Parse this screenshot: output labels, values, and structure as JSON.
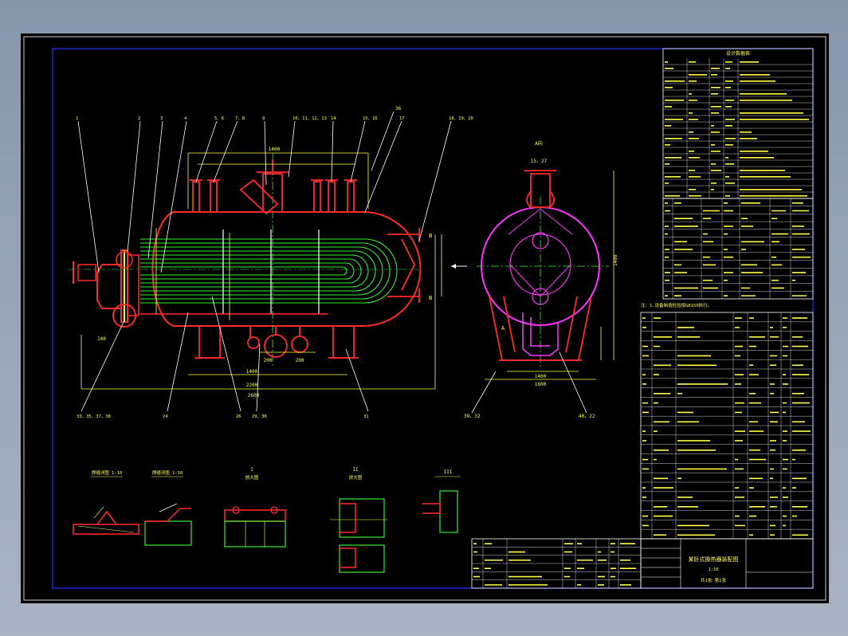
{
  "drawing": {
    "main_view_callouts": [
      "1",
      "2",
      "3",
      "4",
      "5、6",
      "7、8",
      "9",
      "10、11、12、13",
      "14",
      "15、16",
      "17",
      "18、19、20"
    ],
    "top_callout": "36",
    "bottom_callouts": [
      "33、35、37、38",
      "24",
      "26",
      "29、30",
      "31"
    ],
    "side_view_callouts": [
      "39、32",
      "40、22"
    ],
    "side_view_title": "A向",
    "side_nozzle_label": "15、27",
    "dimension_labels": {
      "overall_top": "1400",
      "shell_length": "2200",
      "base_length": "2600",
      "support_spacing": "1400",
      "nozzle_pitch_1": "200",
      "nozzle_pitch_2": "200",
      "height": "1400",
      "side_width": "1400",
      "side_base": "1600",
      "left_offset": "140"
    },
    "view_labels": {
      "A": "A",
      "B": "B"
    }
  },
  "details": [
    {
      "title": "焊缝详图 1:10",
      "subtitle": ""
    },
    {
      "title": "焊缝详图 1:10",
      "subtitle": ""
    },
    {
      "title": "I",
      "subtitle": "放大图"
    },
    {
      "title": "II",
      "subtitle": "放大图"
    },
    {
      "title": "III",
      "subtitle": ""
    }
  ],
  "tech_table": {
    "title": "设计数据表",
    "note": "注：1.设备制造检验按GB150执行。"
  },
  "title_block": {
    "title": "某卧式换热器装配图",
    "scale": "1:10",
    "sheet": "共1张 第1张"
  },
  "colors": {
    "shell": "#ff2a2a",
    "tubes": "#33ee33",
    "dims": "#ffff44",
    "lines": "#ffffff",
    "frame": "#2233ff",
    "magenta": "#ff33ff"
  }
}
